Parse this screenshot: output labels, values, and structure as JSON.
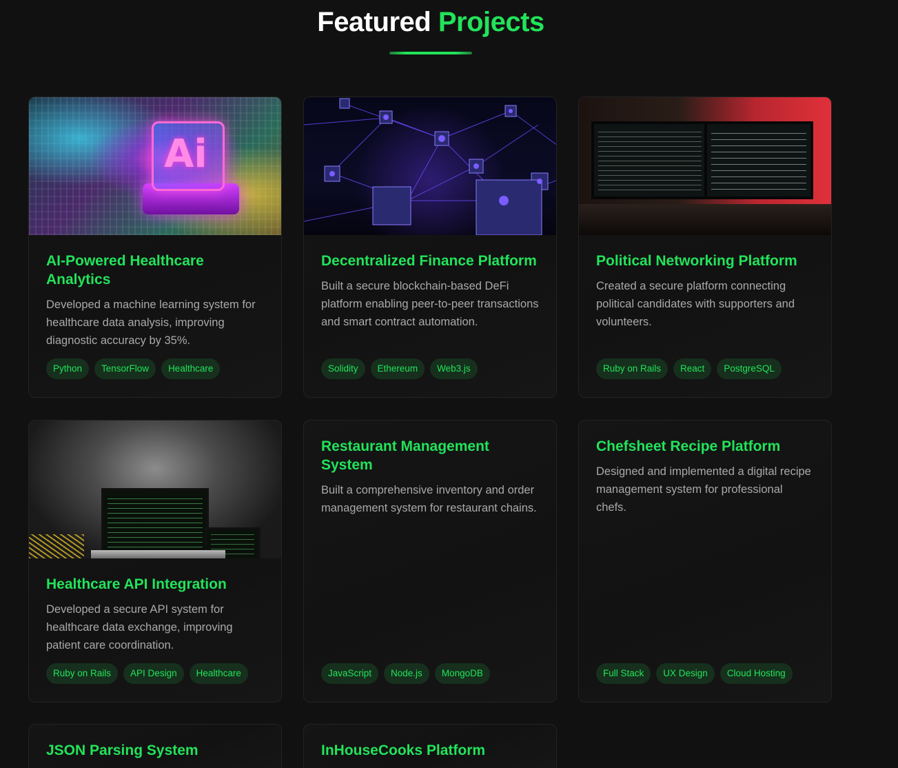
{
  "section": {
    "title_part1": "Featured",
    "title_part2": "Projects"
  },
  "colors": {
    "accent": "#22e35a",
    "background": "#111111",
    "card": "#141414",
    "tag_bg": "#16301d",
    "text_muted": "#a9a9a9"
  },
  "projects": [
    {
      "title": "AI-Powered Healthcare Analytics",
      "description": "Developed a machine learning system for healthcare data analysis, improving diagnostic accuracy by 35%.",
      "tags": [
        "Python",
        "TensorFlow",
        "Healthcare"
      ],
      "image": "ai-chip-image"
    },
    {
      "title": "Decentralized Finance Platform",
      "description": "Built a secure blockchain-based DeFi platform enabling peer-to-peer transactions and smart contract automation.",
      "tags": [
        "Solidity",
        "Ethereum",
        "Web3.js"
      ],
      "image": "blockchain-network-image"
    },
    {
      "title": "Political Networking Platform",
      "description": "Created a secure platform connecting political candidates with supporters and volunteers.",
      "tags": [
        "Ruby on Rails",
        "React",
        "PostgreSQL"
      ],
      "image": "developer-desk-image"
    },
    {
      "title": "Healthcare API Integration",
      "description": "Developed a secure API system for healthcare data exchange, improving patient care coordination.",
      "tags": [
        "Ruby on Rails",
        "API Design",
        "Healthcare"
      ],
      "image": "laptop-code-image"
    },
    {
      "title": "Restaurant Management System",
      "description": "Built a comprehensive inventory and order management system for restaurant chains.",
      "tags": [
        "JavaScript",
        "Node.js",
        "MongoDB"
      ]
    },
    {
      "title": "Chefsheet Recipe Platform",
      "description": "Designed and implemented a digital recipe management system for professional chefs.",
      "tags": [
        "Full Stack",
        "UX Design",
        "Cloud Hosting"
      ]
    },
    {
      "title": "JSON Parsing System"
    },
    {
      "title": "InHouseCooks Platform"
    }
  ]
}
